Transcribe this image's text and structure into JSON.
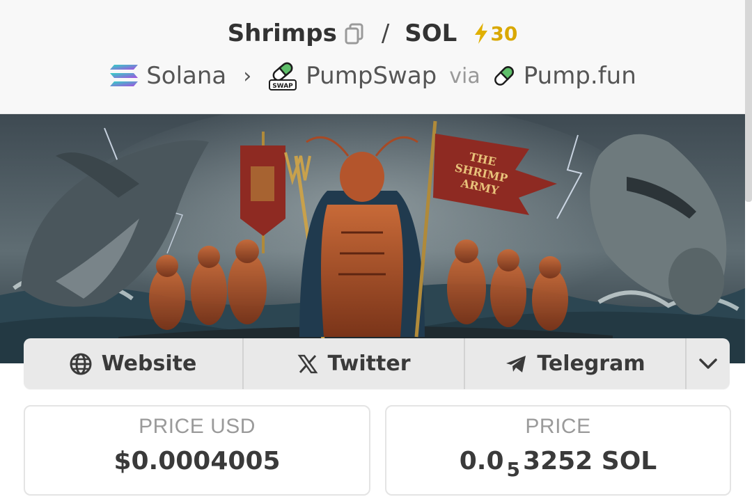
{
  "pair": {
    "base": "Shrimps",
    "separator": "/",
    "quote": "SOL",
    "boost": "30"
  },
  "chain": {
    "network": "Solana",
    "dex": "PumpSwap",
    "via_label": "via",
    "launchpad": "Pump.fun",
    "swap_badge": "SWAP"
  },
  "banner": {
    "flag_text": "THE SHRIMP ARMY"
  },
  "links": {
    "website": "Website",
    "twitter": "Twitter",
    "telegram": "Telegram"
  },
  "stats": {
    "price_usd_label": "PRICE USD",
    "price_usd_value": "$0.0004005",
    "price_label": "PRICE",
    "price_prefix": "0.0",
    "price_zeros": "5",
    "price_digits": "3252",
    "price_unit": "SOL"
  },
  "colors": {
    "boost": "#d9a800",
    "header_bg": "#f8f8f8",
    "links_bg": "#e9e9e9"
  }
}
